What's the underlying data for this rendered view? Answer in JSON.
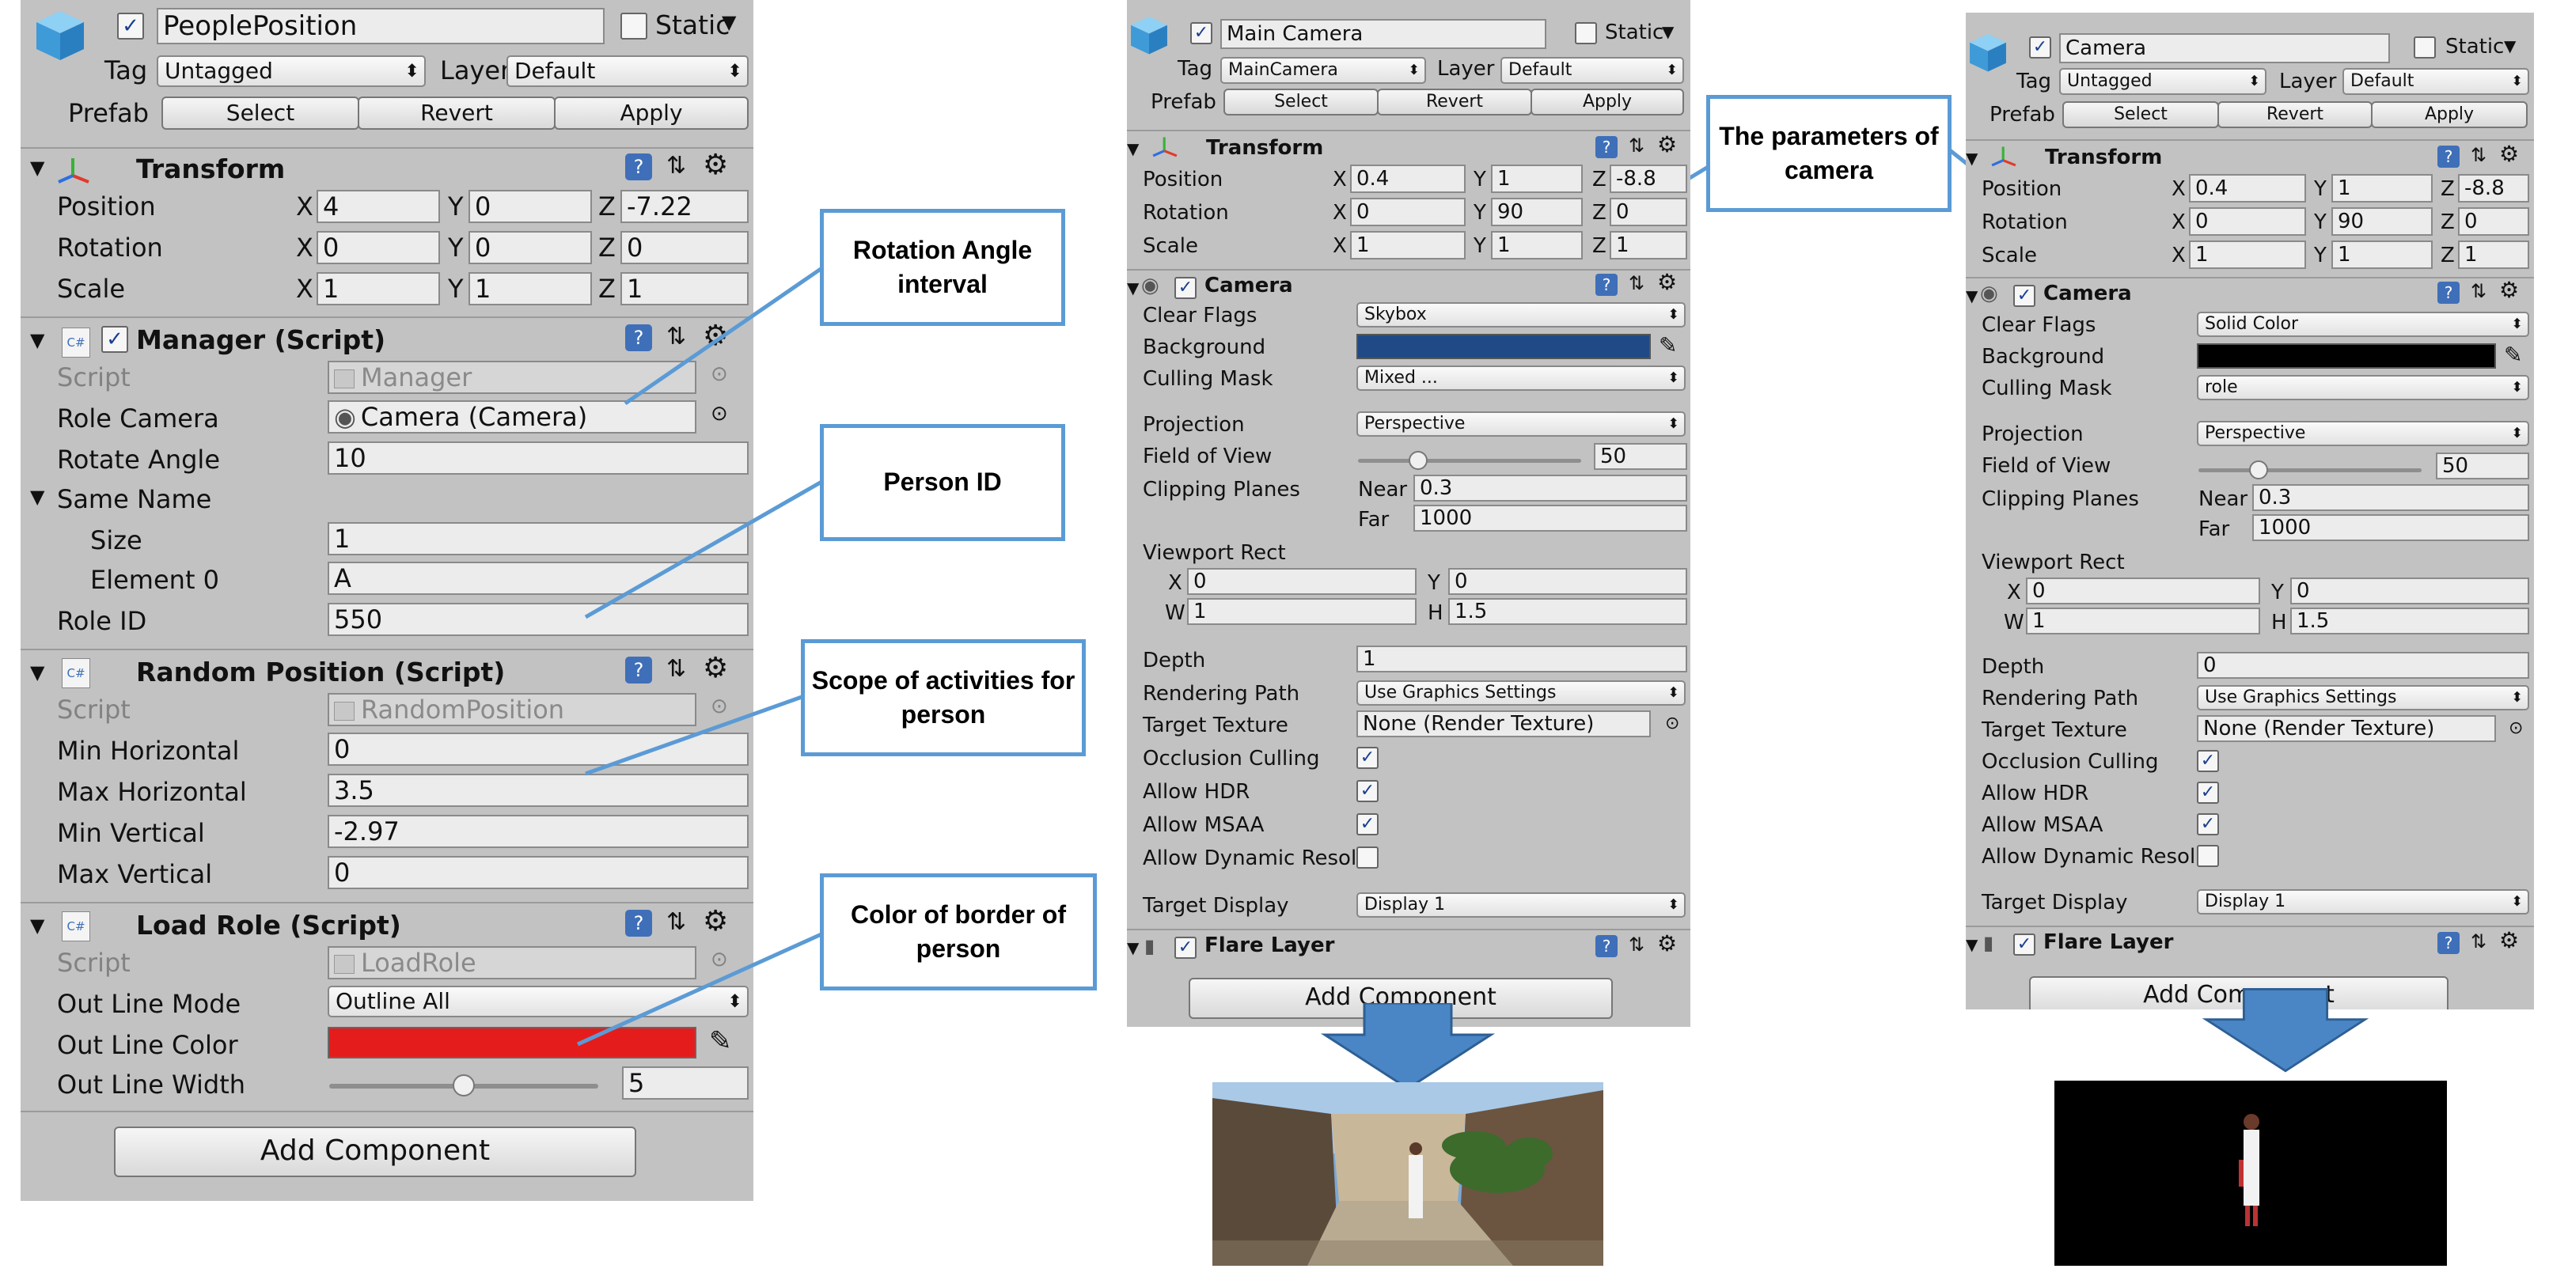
{
  "left": {
    "object_name": "PeoplePosition",
    "static_label": "Static",
    "tag_label": "Tag",
    "tag_value": "Untagged",
    "layer_label": "Layer",
    "layer_value": "Default",
    "prefab_label": "Prefab",
    "prefab_select": "Select",
    "prefab_revert": "Revert",
    "prefab_apply": "Apply",
    "transform_title": "Transform",
    "position_label": "Position",
    "rotation_label": "Rotation",
    "scale_label": "Scale",
    "x": "X",
    "y": "Y",
    "z": "Z",
    "pos_x": "4",
    "pos_y": "0",
    "pos_z": "-7.22",
    "rot_x": "0",
    "rot_y": "0",
    "rot_z": "0",
    "scl_x": "1",
    "scl_y": "1",
    "scl_z": "1",
    "manager_title": "Manager (Script)",
    "script_label": "Script",
    "manager_script": "Manager",
    "role_camera_label": "Role Camera",
    "role_camera_value": "Camera (Camera)",
    "rotate_angle_label": "Rotate Angle",
    "rotate_angle_value": "10",
    "same_name_label": "Same Name",
    "size_label": "Size",
    "size_value": "1",
    "element0_label": "Element 0",
    "element0_value": "A",
    "role_id_label": "Role ID",
    "role_id_value": "550",
    "random_title": "Random Position (Script)",
    "random_script": "RandomPosition",
    "min_h_label": "Min Horizontal",
    "min_h_value": "0",
    "max_h_label": "Max Horizontal",
    "max_h_value": "3.5",
    "min_v_label": "Min Vertical",
    "min_v_value": "-2.97",
    "max_v_label": "Max Vertical",
    "max_v_value": "0",
    "load_title": "Load Role (Script)",
    "load_script": "LoadRole",
    "outline_mode_label": "Out Line Mode",
    "outline_mode_value": "Outline All",
    "outline_color_label": "Out Line Color",
    "outline_color": "#e51c1c",
    "outline_width_label": "Out Line Width",
    "outline_width_value": "5",
    "outline_width_fraction": 0.5,
    "add_component": "Add Component",
    "cs_badge": "C#"
  },
  "annotations": {
    "rotation": "Rotation Angle interval",
    "person_id": "Person ID",
    "scope": "Scope of activities for person",
    "color": "Color of border of person",
    "camera_params": "The parameters of camera"
  },
  "cam1": {
    "object_name": "Main Camera",
    "static_label": "Static",
    "tag_label": "Tag",
    "tag_value": "MainCamera",
    "layer_label": "Layer",
    "layer_value": "Default",
    "prefab_label": "Prefab",
    "prefab_select": "Select",
    "prefab_revert": "Revert",
    "prefab_apply": "Apply",
    "transform_title": "Transform",
    "position_label": "Position",
    "rotation_label": "Rotation",
    "scale_label": "Scale",
    "x": "X",
    "y": "Y",
    "z": "Z",
    "w": "W",
    "h": "H",
    "pos_x": "0.4",
    "pos_y": "1",
    "pos_z": "-8.8",
    "rot_x": "0",
    "rot_y": "90",
    "rot_z": "0",
    "scl_x": "1",
    "scl_y": "1",
    "scl_z": "1",
    "camera_title": "Camera",
    "clear_flags_label": "Clear Flags",
    "clear_flags_value": "Skybox",
    "background_label": "Background",
    "background_color": "#1f4a86",
    "culling_label": "Culling Mask",
    "culling_value": "Mixed ...",
    "projection_label": "Projection",
    "projection_value": "Perspective",
    "fov_label": "Field of View",
    "fov_value": "50",
    "fov_fraction": 0.27,
    "clipping_label": "Clipping Planes",
    "near_label": "Near",
    "near_value": "0.3",
    "far_label": "Far",
    "far_value": "1000",
    "viewport_label": "Viewport Rect",
    "vp_x": "0",
    "vp_y": "0",
    "vp_w": "1",
    "vp_h": "1.5",
    "depth_label": "Depth",
    "depth_value": "1",
    "rendering_label": "Rendering Path",
    "rendering_value": "Use Graphics Settings",
    "target_texture_label": "Target Texture",
    "target_texture_value": "None (Render Texture)",
    "occlusion_label": "Occlusion Culling",
    "hdr_label": "Allow HDR",
    "msaa_label": "Allow MSAA",
    "dynres_label": "Allow Dynamic Resolu",
    "target_display_label": "Target Display",
    "target_display_value": "Display 1",
    "flare_title": "Flare Layer",
    "add_component": "Add Component"
  },
  "cam2": {
    "object_name": "Camera",
    "static_label": "Static",
    "tag_label": "Tag",
    "tag_value": "Untagged",
    "layer_label": "Layer",
    "layer_value": "Default",
    "prefab_label": "Prefab",
    "prefab_select": "Select",
    "prefab_revert": "Revert",
    "prefab_apply": "Apply",
    "transform_title": "Transform",
    "position_label": "Position",
    "rotation_label": "Rotation",
    "scale_label": "Scale",
    "x": "X",
    "y": "Y",
    "z": "Z",
    "w": "W",
    "h": "H",
    "pos_x": "0.4",
    "pos_y": "1",
    "pos_z": "-8.8",
    "rot_x": "0",
    "rot_y": "90",
    "rot_z": "0",
    "scl_x": "1",
    "scl_y": "1",
    "scl_z": "1",
    "camera_title": "Camera",
    "clear_flags_label": "Clear Flags",
    "clear_flags_value": "Solid Color",
    "background_label": "Background",
    "background_color": "#000000",
    "culling_label": "Culling Mask",
    "culling_value": "role",
    "projection_label": "Projection",
    "projection_value": "Perspective",
    "fov_label": "Field of View",
    "fov_value": "50",
    "fov_fraction": 0.27,
    "clipping_label": "Clipping Planes",
    "near_label": "Near",
    "near_value": "0.3",
    "far_label": "Far",
    "far_value": "1000",
    "viewport_label": "Viewport Rect",
    "vp_x": "0",
    "vp_y": "0",
    "vp_w": "1",
    "vp_h": "1.5",
    "depth_label": "Depth",
    "depth_value": "0",
    "rendering_label": "Rendering Path",
    "rendering_value": "Use Graphics Settings",
    "target_texture_label": "Target Texture",
    "target_texture_value": "None (Render Texture)",
    "occlusion_label": "Occlusion Culling",
    "hdr_label": "Allow HDR",
    "msaa_label": "Allow MSAA",
    "dynres_label": "Allow Dynamic Resolu",
    "target_display_label": "Target Display",
    "target_display_value": "Display 1",
    "flare_title": "Flare Layer",
    "add_component": "Add Component"
  },
  "colors": {
    "accent_blue": "#5b9bd5",
    "inspector_bg": "#c2c2c2",
    "checkmark": "#1a3f8f"
  }
}
